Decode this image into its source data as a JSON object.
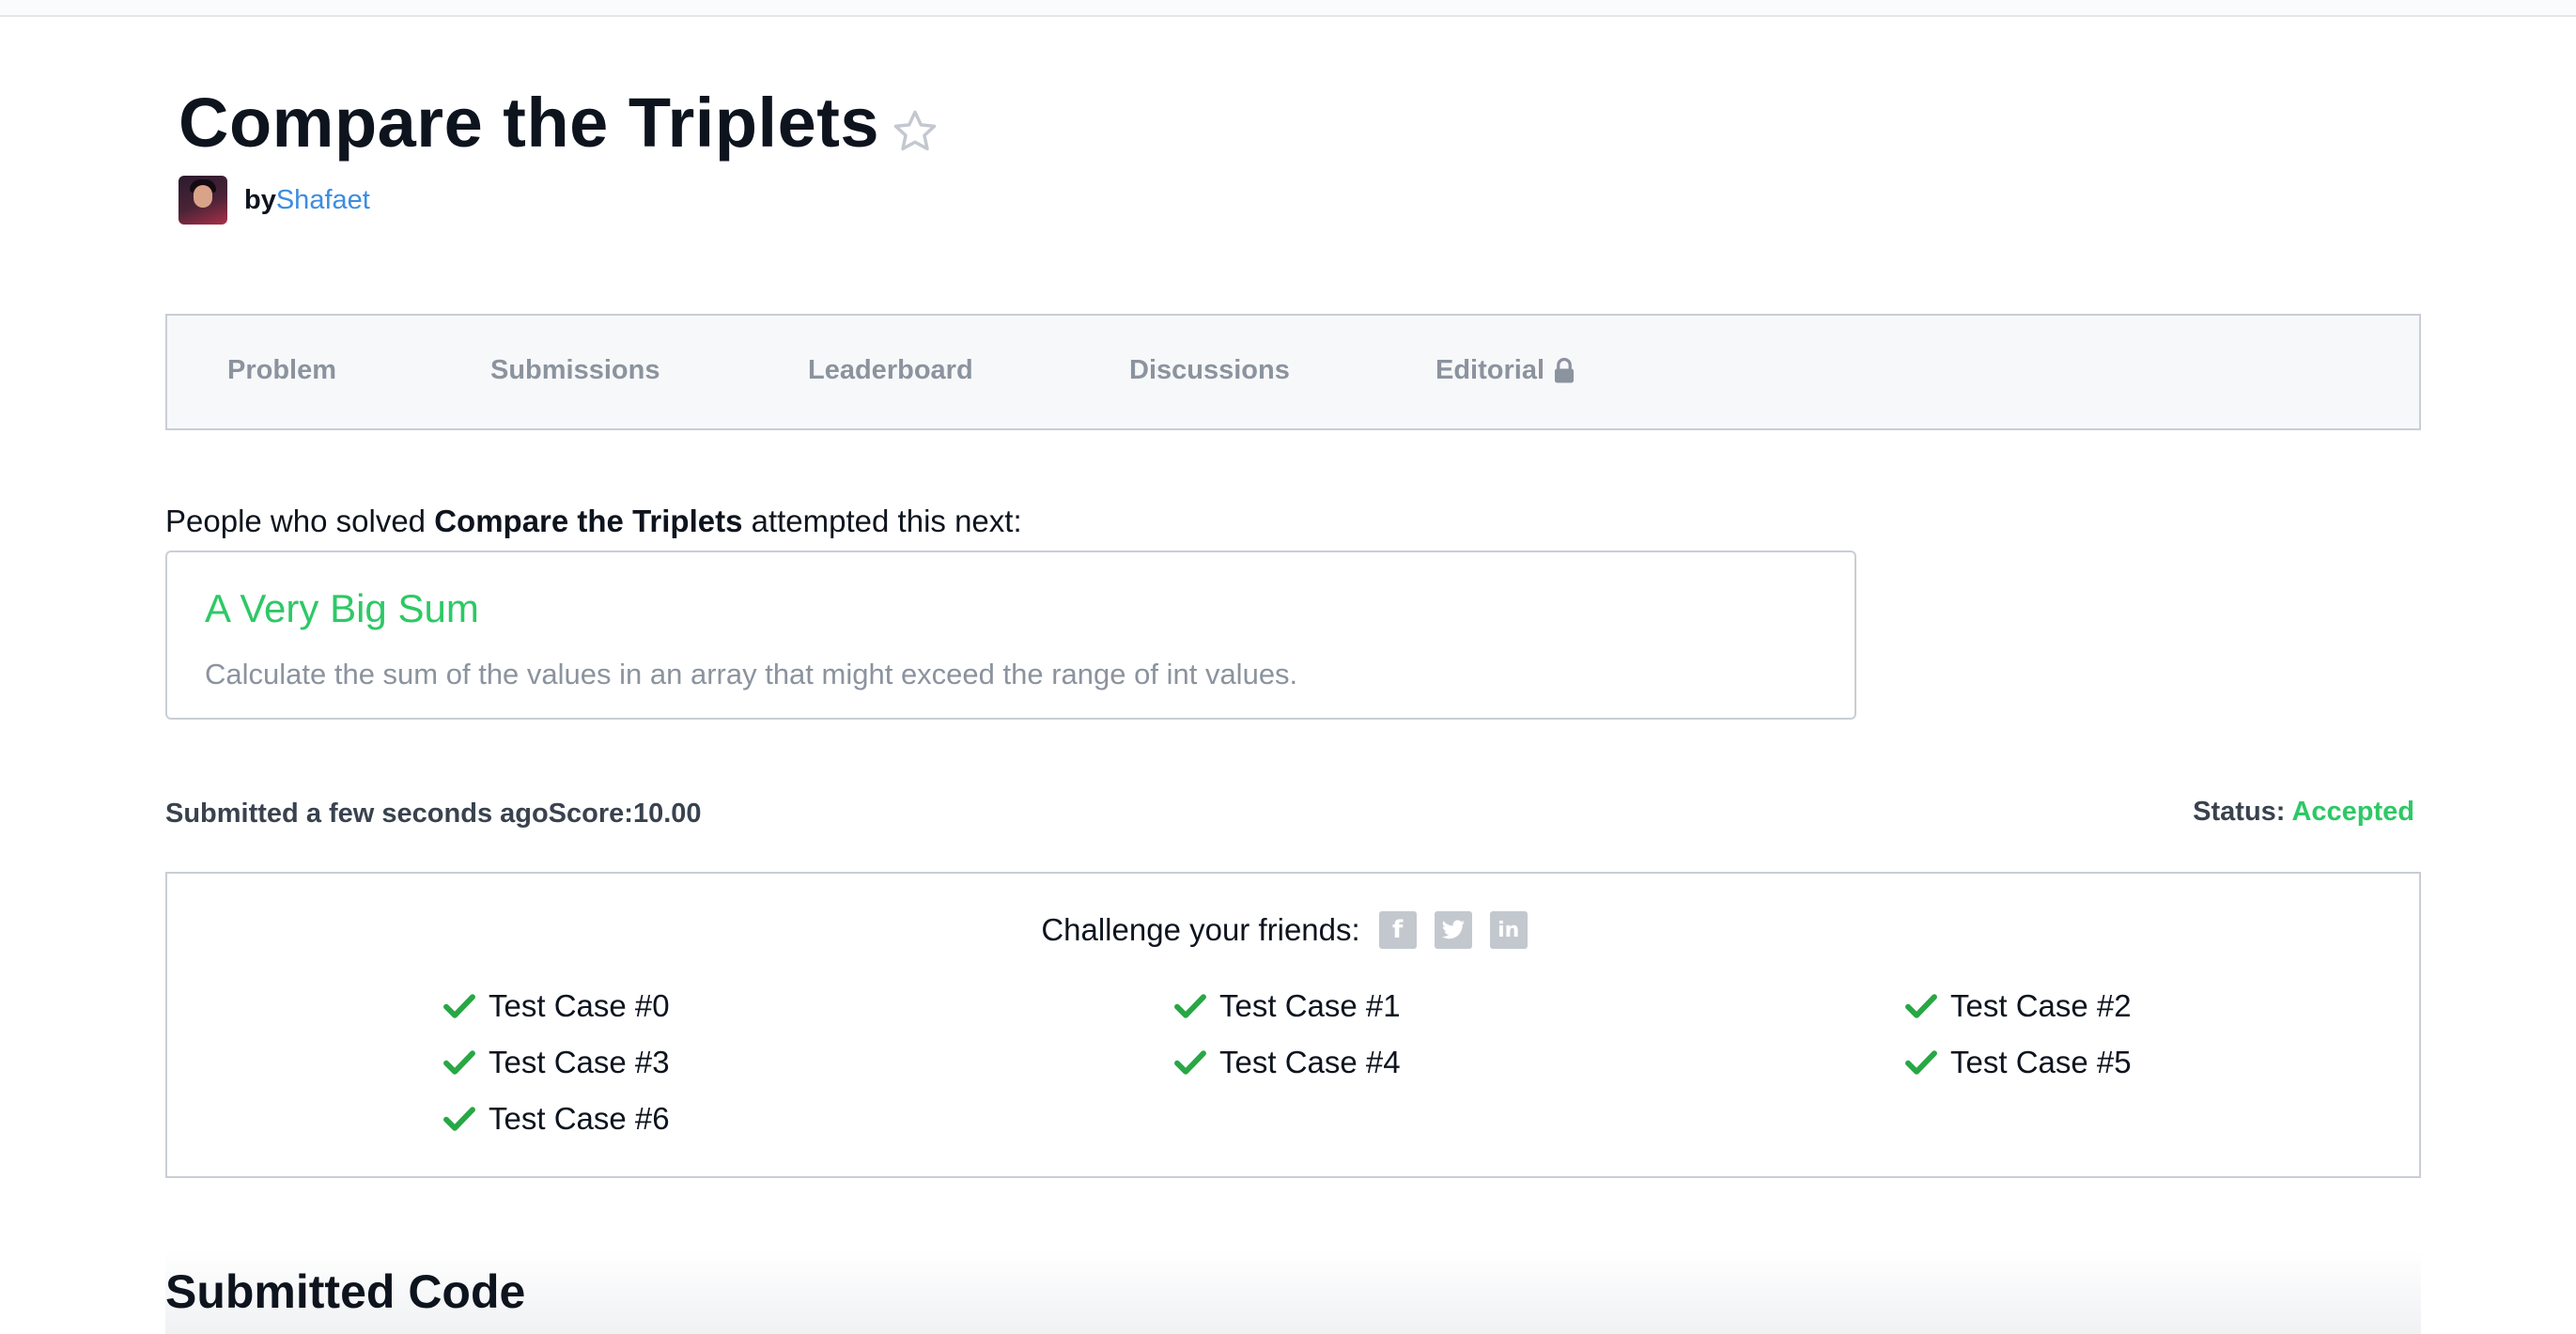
{
  "challenge": {
    "title": "Compare the Triplets",
    "by_label": "by",
    "author": "Shafaet"
  },
  "tabs": [
    {
      "label": "Problem"
    },
    {
      "label": "Submissions"
    },
    {
      "label": "Leaderboard"
    },
    {
      "label": "Discussions"
    },
    {
      "label": "Editorial"
    }
  ],
  "next": {
    "prefix": "People who solved ",
    "challenge_name": "Compare the Triplets",
    "suffix": " attempted this next:",
    "card_title": "A Very Big Sum",
    "card_desc": "Calculate the sum of the values in an array that might exceed the range of int values."
  },
  "submission": {
    "submitted_text": "Submitted a few seconds agoScore:10.00",
    "status_label": "Status: ",
    "status_value": "Accepted",
    "status_color": "#2ec866"
  },
  "results": {
    "challenge_text": "Challenge your friends:",
    "share": [
      {
        "icon": "facebook-icon",
        "glyph": "f"
      },
      {
        "icon": "twitter-icon",
        "glyph": "t"
      },
      {
        "icon": "linkedin-icon",
        "glyph": "in"
      }
    ],
    "test_cases": [
      "Test Case #0",
      "Test Case #1",
      "Test Case #2",
      "Test Case #3",
      "Test Case #4",
      "Test Case #5",
      "Test Case #6"
    ]
  },
  "code": {
    "heading": "Submitted Code"
  },
  "colors": {
    "accent_green": "#2ec866",
    "link_blue": "#3c8de0",
    "muted_gray": "#8b939e"
  }
}
